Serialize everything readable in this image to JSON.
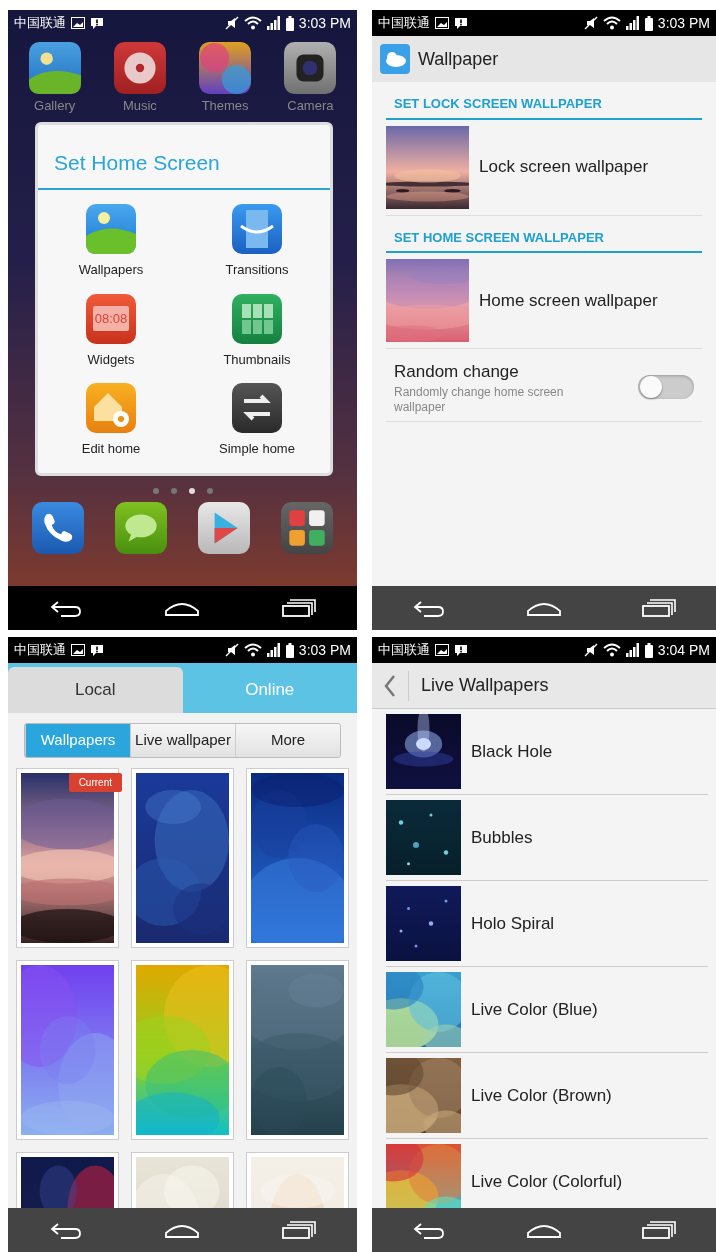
{
  "screens": [
    {
      "kind": "home",
      "status_bar": {
        "carrier": "中国联通",
        "time": "3:03 PM"
      },
      "apps": [
        {
          "label": "Gallery"
        },
        {
          "label": "Music"
        },
        {
          "label": "Themes"
        },
        {
          "label": "Camera"
        }
      ],
      "dialog": {
        "title": "Set Home Screen",
        "items": [
          {
            "label": "Wallpapers"
          },
          {
            "label": "Transitions"
          },
          {
            "label": "Widgets",
            "icon_text": "08:08"
          },
          {
            "label": "Thumbnails"
          },
          {
            "label": "Edit home"
          },
          {
            "label": "Simple home"
          }
        ]
      },
      "page_dots": [
        {
          "selected": false
        },
        {
          "selected": false
        },
        {
          "selected": true
        },
        {
          "selected": false
        }
      ]
    },
    {
      "kind": "wallpaper_settings",
      "status_bar": {
        "carrier": "中国联通",
        "time": "3:03 PM"
      },
      "title": "Wallpaper",
      "sections": [
        {
          "heading": "SET LOCK SCREEN WALLPAPER",
          "items": [
            {
              "label": "Lock screen wallpaper"
            }
          ]
        },
        {
          "heading": "SET HOME SCREEN WALLPAPER",
          "items": [
            {
              "label": "Home screen wallpaper"
            }
          ]
        }
      ],
      "toggle": {
        "title": "Random change",
        "subtitle": "Randomly change home screen wallpaper",
        "on": false
      }
    },
    {
      "kind": "gallery",
      "status_bar": {
        "carrier": "中国联通",
        "time": "3:03 PM"
      },
      "tabs": [
        {
          "label": "Local",
          "selected": true
        },
        {
          "label": "Online",
          "selected": false
        }
      ],
      "segments": [
        {
          "label": "Wallpapers",
          "selected": true
        },
        {
          "label": "Live wallpaper",
          "selected": false
        },
        {
          "label": "More",
          "selected": false
        }
      ],
      "thumbnails": [
        {
          "kind": "picture",
          "badge": "Current"
        },
        {
          "kind": "picture"
        },
        {
          "kind": "picture"
        },
        {
          "kind": "picture"
        },
        {
          "kind": "picture"
        },
        {
          "kind": "picture"
        },
        {
          "kind": "picture"
        },
        {
          "kind": "picture"
        },
        {
          "kind": "picture"
        }
      ]
    },
    {
      "kind": "live_list",
      "status_bar": {
        "carrier": "中国联通",
        "time": "3:04 PM"
      },
      "title": "Live Wallpapers",
      "items": [
        {
          "label": "Black Hole"
        },
        {
          "label": "Bubbles"
        },
        {
          "label": "Holo Spiral"
        },
        {
          "label": "Live Color (Blue)"
        },
        {
          "label": "Live Color (Brown)"
        },
        {
          "label": "Live Color (Colorful)"
        }
      ]
    }
  ]
}
